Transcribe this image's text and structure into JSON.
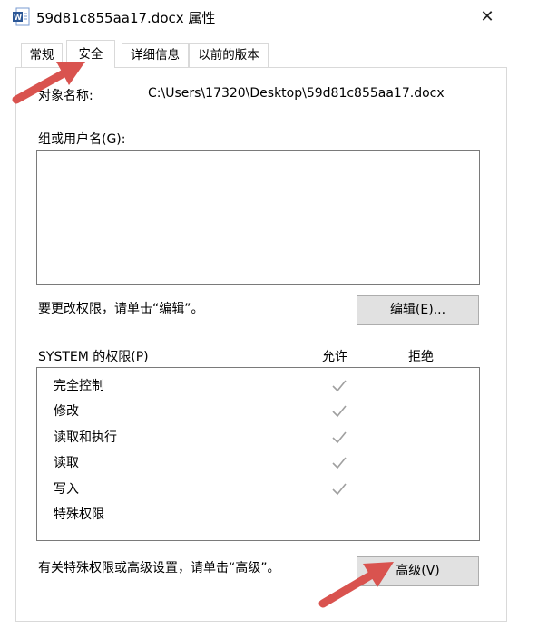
{
  "window": {
    "title": "59d81c855aa17.docx 属性",
    "close_glyph": "✕",
    "icon": "word-doc-icon"
  },
  "tabs": [
    {
      "label": "常规"
    },
    {
      "label": "安全",
      "active": true
    },
    {
      "label": "详细信息"
    },
    {
      "label": "以前的版本"
    }
  ],
  "security": {
    "object_name_label": "对象名称:",
    "object_name_value": "C:\\Users\\17320\\Desktop\\59d81c855aa17.docx",
    "group_label": "组或用户名(G):",
    "edit_hint": "要更改权限，请单击“编辑”。",
    "edit_button": "编辑(E)...",
    "perm_title": "SYSTEM 的权限(P)",
    "col_allow": "允许",
    "col_deny": "拒绝",
    "permissions": [
      {
        "name": "完全控制",
        "allow": true
      },
      {
        "name": "修改",
        "allow": true
      },
      {
        "name": "读取和执行",
        "allow": true
      },
      {
        "name": "读取",
        "allow": true
      },
      {
        "name": "写入",
        "allow": true
      },
      {
        "name": "特殊权限",
        "allow": false
      }
    ],
    "advanced_hint": "有关特殊权限或高级设置，请单击“高级”。",
    "advanced_button": "高级(V)"
  },
  "colors": {
    "arrow": "#d9534f",
    "check": "#a0a0a0",
    "button_bg": "#e1e1e1"
  }
}
